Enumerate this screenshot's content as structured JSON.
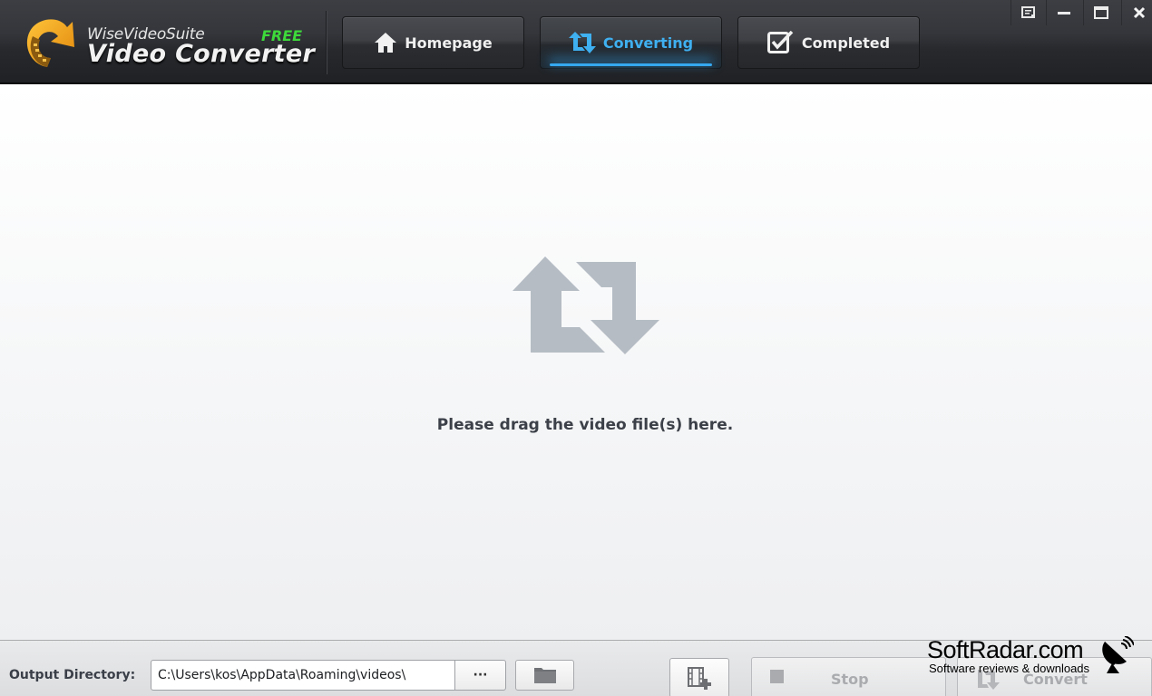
{
  "app": {
    "brand_subtitle": "WiseVideoSuite",
    "brand_title": "Video Converter",
    "edition_badge": "FREE",
    "accent_color": "#35a8f0",
    "edition_color": "#3dd83a"
  },
  "nav": {
    "tabs": [
      {
        "label": "Homepage",
        "icon": "home-icon",
        "active": false
      },
      {
        "label": "Converting",
        "icon": "convert-arrows-icon",
        "active": true
      },
      {
        "label": "Completed",
        "icon": "checkbox-icon",
        "active": false
      }
    ]
  },
  "window_controls": [
    "feedback-icon",
    "minimize-icon",
    "maximize-icon",
    "close-icon"
  ],
  "main": {
    "drop_icon": "convert-arrows-icon",
    "drop_hint": "Please drag the video file(s) here."
  },
  "bottom": {
    "output_label": "Output Directory:",
    "output_path": "C:\\Users\\kos\\AppData\\Roaming\\videos\\",
    "browse_label": "···",
    "open_folder_icon": "folder-icon",
    "add_video_icon": "add-video-icon",
    "stop_label": "Stop",
    "convert_label": "Convert"
  },
  "watermark": {
    "title": "SoftRadar.com",
    "subtitle": "Software reviews & downloads"
  }
}
